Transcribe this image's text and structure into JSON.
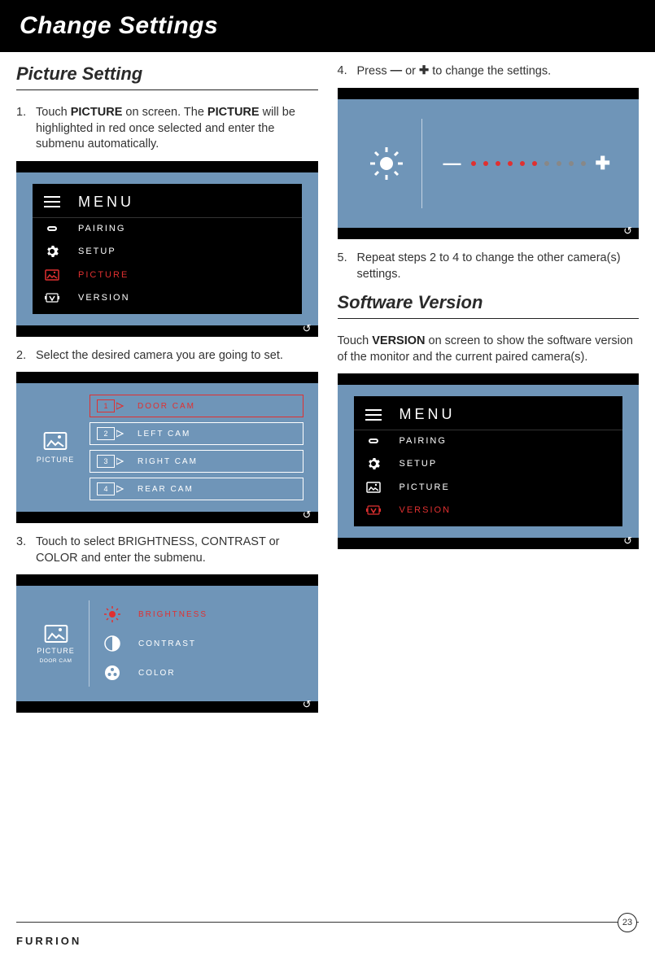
{
  "header": {
    "title": "Change Settings"
  },
  "left": {
    "heading": "Picture Setting",
    "step1_prefix": "Touch ",
    "step1_bold1": "PICTURE",
    "step1_mid": " on screen. The ",
    "step1_bold2": "PICTURE",
    "step1_suffix": " will be highlighted in red once selected and enter the submenu automatically.",
    "step2": "Select the desired camera you are going to set.",
    "step3": "Touch to select BRIGHTNESS, CONTRAST or COLOR and enter the submenu."
  },
  "right": {
    "step4_prefix": "Press ",
    "step4_mid": " or ",
    "step4_suffix": " to change the settings.",
    "step5": "Repeat steps 2 to 4 to change the other camera(s) settings.",
    "sv_heading": "Software Version",
    "sv_text_prefix": "Touch ",
    "sv_text_bold": "VERSION",
    "sv_text_suffix": " on screen to show the software version of the monitor and the current paired camera(s)."
  },
  "menu": {
    "title": "MENU",
    "items": [
      {
        "icon": "link-icon",
        "label": "PAIRING"
      },
      {
        "icon": "gear-icon",
        "label": "SETUP"
      },
      {
        "icon": "picture-icon",
        "label": "PICTURE"
      },
      {
        "icon": "version-icon",
        "label": "VERSION"
      }
    ]
  },
  "cameras": {
    "side_label": "PICTURE",
    "items": [
      {
        "num": "1",
        "label": "DOOR CAM"
      },
      {
        "num": "2",
        "label": "LEFT CAM"
      },
      {
        "num": "3",
        "label": "RIGHT CAM"
      },
      {
        "num": "4",
        "label": "REAR CAM"
      }
    ]
  },
  "picsub": {
    "side1": "PICTURE",
    "side2": "DOOR CAM",
    "items": [
      {
        "label": "BRIGHTNESS"
      },
      {
        "label": "CONTRAST"
      },
      {
        "label": "COLOR"
      }
    ]
  },
  "slider": {
    "total": 10,
    "filled": 6
  },
  "footer": {
    "brand": "FURRION",
    "page": "23"
  }
}
